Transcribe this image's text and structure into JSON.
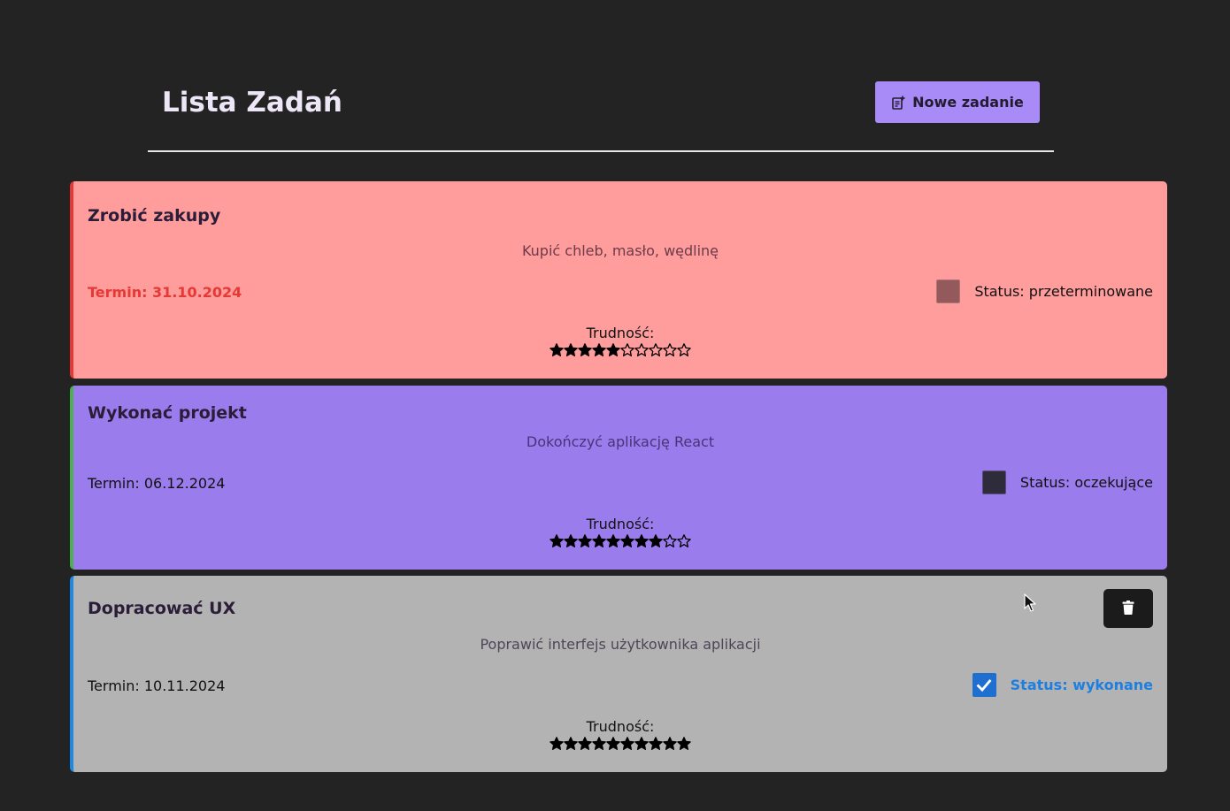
{
  "header": {
    "title": "Lista Zadań",
    "new_task_label": "Nowe zadanie"
  },
  "difficulty_label": "Trudność:",
  "tasks": [
    {
      "title": "Zrobić zakupy",
      "description": "Kupić chleb, masło, wędlinę",
      "deadline": "Termin: 31.10.2024",
      "status": "Status: przeterminowane",
      "status_kind": "overdue",
      "checked": false,
      "difficulty": 5,
      "difficulty_max": 10,
      "card_color": "#ff9c9c",
      "accent_color": "#e53935"
    },
    {
      "title": "Wykonać projekt",
      "description": "Dokończyć aplikację React",
      "deadline": "Termin: 06.12.2024",
      "status": "Status: oczekujące",
      "status_kind": "pending",
      "checked": false,
      "difficulty": 8,
      "difficulty_max": 10,
      "card_color": "#9b7ced",
      "accent_color": "#4caf50"
    },
    {
      "title": "Dopracować UX",
      "description": "Poprawić interfejs użytkownika aplikacji",
      "deadline": "Termin: 10.11.2024",
      "status": "Status: wykonane",
      "status_kind": "done",
      "checked": true,
      "difficulty": 10,
      "difficulty_max": 10,
      "card_color": "#b3b3b3",
      "accent_color": "#1e88e5"
    }
  ],
  "icons": {
    "new_task": "note-add-icon",
    "delete": "trash-icon",
    "star_filled": "star-filled-icon",
    "star_empty": "star-empty-icon",
    "check": "check-icon"
  }
}
